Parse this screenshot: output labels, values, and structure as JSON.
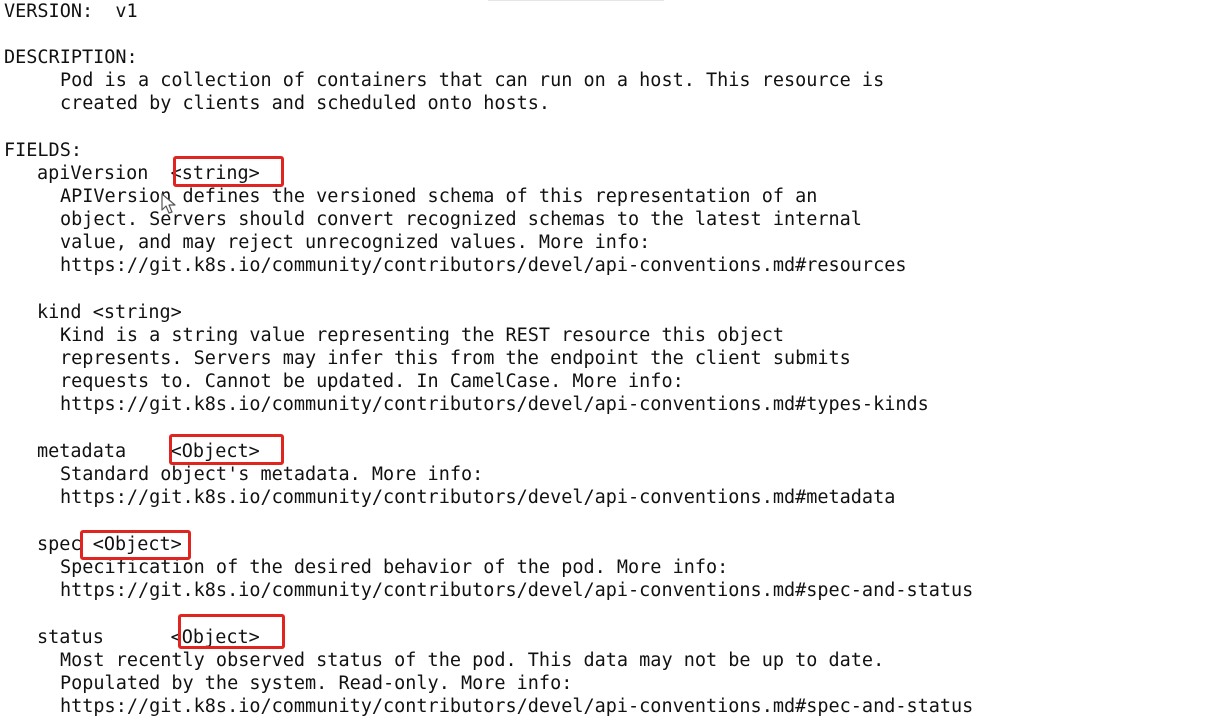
{
  "version_line": "VERSION:  v1",
  "description": {
    "heading": "DESCRIPTION:",
    "lines": [
      "Pod is a collection of containers that can run on a host. This resource is",
      "created by clients and scheduled onto hosts."
    ]
  },
  "fields_heading": "FIELDS:",
  "fields": [
    {
      "header": "apiVersion  <string>",
      "lines": [
        "APIVersion defines the versioned schema of this representation of an",
        "object. Servers should convert recognized schemas to the latest internal",
        "value, and may reject unrecognized values. More info:",
        "https://git.k8s.io/community/contributors/devel/api-conventions.md#resources"
      ]
    },
    {
      "header": "kind <string>",
      "lines": [
        "Kind is a string value representing the REST resource this object",
        "represents. Servers may infer this from the endpoint the client submits",
        "requests to. Cannot be updated. In CamelCase. More info:",
        "https://git.k8s.io/community/contributors/devel/api-conventions.md#types-kinds"
      ]
    },
    {
      "header": "metadata    <Object>",
      "lines": [
        "Standard object's metadata. More info:",
        "https://git.k8s.io/community/contributors/devel/api-conventions.md#metadata"
      ]
    },
    {
      "header": "spec <Object>",
      "lines": [
        "Specification of the desired behavior of the pod. More info:",
        "https://git.k8s.io/community/contributors/devel/api-conventions.md#spec-and-status"
      ]
    },
    {
      "header": "status      <Object>",
      "lines": [
        "Most recently observed status of the pod. This data may not be up to date.",
        "Populated by the system. Read-only. More info:",
        "https://git.k8s.io/community/contributors/devel/api-conventions.md#spec-and-status"
      ]
    }
  ],
  "colors": {
    "text": "#111111",
    "background": "#ffffff",
    "highlight_box": "#e0241f"
  },
  "icons": [
    "mouse-pointer-icon"
  ]
}
